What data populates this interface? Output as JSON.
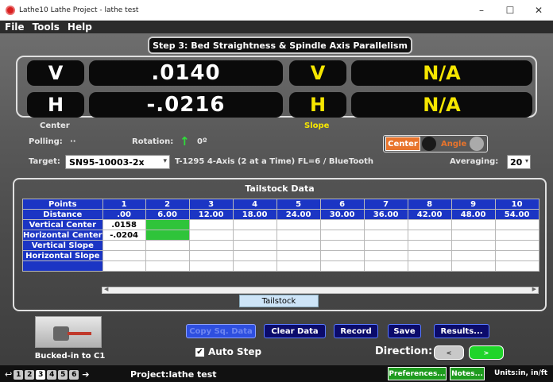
{
  "window": {
    "title": "Lathe10 Lathe Project - lathe test",
    "minimize": "–",
    "maximize": "☐",
    "close": "✕"
  },
  "menu": [
    "File",
    "Tools",
    "Help"
  ],
  "step_title": "Step 3: Bed Straightness & Spindle Axis Parallelism",
  "display": {
    "left_v_label": "V",
    "left_v_value": ".0140",
    "left_h_label": "H",
    "left_h_value": "-.0216",
    "right_v_label": "V",
    "right_v_value": "N/A",
    "right_h_label": "H",
    "right_h_value": "N/A",
    "center_label": "Center",
    "slope_label": "Slope"
  },
  "status": {
    "polling_label": "Polling:",
    "polling_value": "··",
    "rotation_label": "Rotation:",
    "rotation_value": "0º",
    "target_label": "Target:",
    "target_value": "SN95-10003-2x",
    "target_desc": "T-1295 4-Axis (2 at a Time) FL=6 / BlueTooth",
    "averaging_label": "Averaging:",
    "averaging_value": "20"
  },
  "toggle": {
    "center": "Center",
    "angle": "Angle"
  },
  "table": {
    "title": "Tailstock Data",
    "row_headers": [
      "Points",
      "Distance",
      "Vertical Center",
      "Horizontal Center",
      "Vertical Slope",
      "Horizontal Slope",
      ""
    ],
    "points": [
      "1",
      "2",
      "3",
      "4",
      "5",
      "6",
      "7",
      "8",
      "9",
      "10"
    ],
    "distance": [
      ".00",
      "6.00",
      "12.00",
      "18.00",
      "24.00",
      "30.00",
      "36.00",
      "42.00",
      "48.00",
      "54.00"
    ],
    "vertical_center": [
      ".0158",
      "",
      "",
      "",
      "",
      "",
      "",
      "",
      "",
      ""
    ],
    "horizontal_center": [
      "-.0204",
      "",
      "",
      "",
      "",
      "",
      "",
      "",
      "",
      ""
    ],
    "highlight_color": "#2fc43a"
  },
  "tab_label": "Tailstock",
  "thumbnail_caption": "Bucked-in to C1",
  "buttons": {
    "copy": "Copy Sq. Data",
    "clear": "Clear Data",
    "record": "Record",
    "save": "Save",
    "results": "Results..."
  },
  "auto_step": {
    "label": "Auto Step",
    "checked": "✔"
  },
  "direction": {
    "label": "Direction:",
    "left": "<",
    "right": ">"
  },
  "footer": {
    "steps": [
      "1",
      "2",
      "3",
      "4",
      "5",
      "6"
    ],
    "project": "Project:lathe test",
    "preferences": "Preferences...",
    "notes": "Notes...",
    "units": "Units:in, in/ft"
  },
  "colors": {
    "accent_blue": "#1b35c4",
    "yellow": "#f6e600",
    "orange": "#e8742c",
    "green": "#1e9b1e"
  }
}
